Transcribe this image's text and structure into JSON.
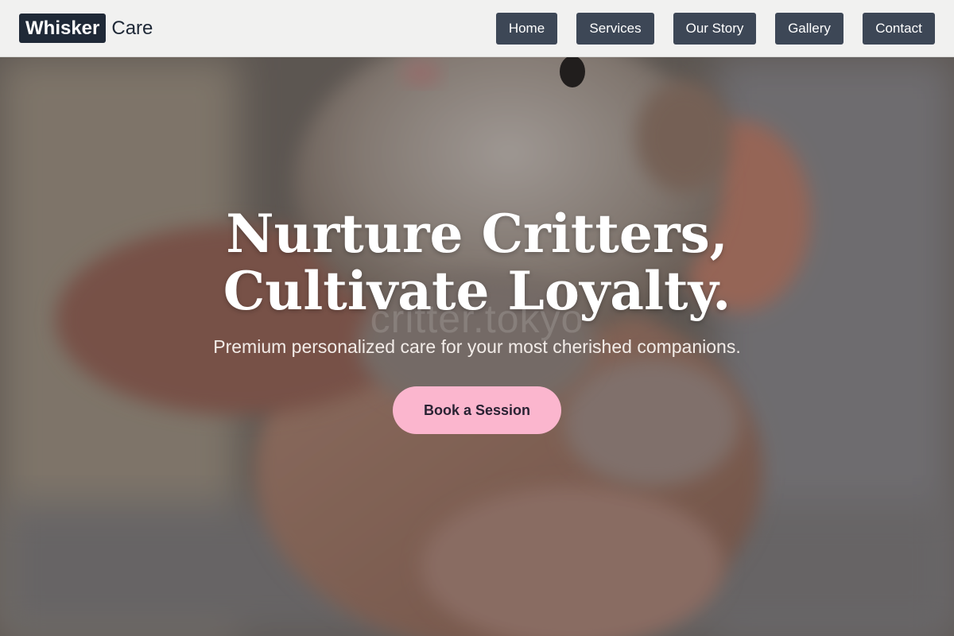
{
  "brand": {
    "logo_box_text": "Whisker",
    "logo_rest_text": "Care"
  },
  "nav": {
    "items": [
      {
        "label": "Home"
      },
      {
        "label": "Services"
      },
      {
        "label": "Our Story"
      },
      {
        "label": "Gallery"
      },
      {
        "label": "Contact"
      }
    ]
  },
  "hero": {
    "headline_line1": "Nurture Critters,",
    "headline_line2": "Cultivate Loyalty.",
    "watermark": "critter.tokyo",
    "subtitle": "Premium personalized care for your most cherished companions.",
    "cta_label": "Book a Session"
  },
  "colors": {
    "header_bg": "#f1f1f0",
    "nav_button_bg": "#3d4756",
    "logo_box_bg": "#1f2937",
    "cta_bg": "#fbb6ce",
    "cta_text": "#2a2233"
  },
  "icons": {
    "hero_image": "hamster-in-hand-photo"
  }
}
